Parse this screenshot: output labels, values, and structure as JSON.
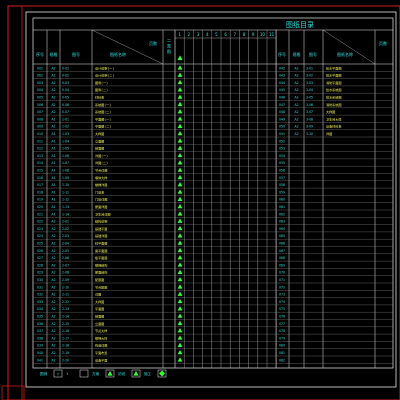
{
  "sheet": {
    "title": "图纸目录",
    "left_headers": {
      "seq": "序号",
      "size": "规格",
      "code": "图号",
      "name": "图纸名称",
      "diag": "页数"
    },
    "right_headers": {
      "seq": "序号",
      "size": "规格",
      "code": "图号",
      "name": "图纸名称",
      "diag": "页数"
    },
    "mid_header": "二类图",
    "cols": [
      "1",
      "2",
      "3",
      "4",
      "5",
      "6",
      "7",
      "8",
      "9",
      "10",
      "11"
    ],
    "left_rows": [
      {
        "seq": "001",
        "size": "A2",
        "code": "0-01",
        "name": "设计说明(一)"
      },
      {
        "seq": "002",
        "size": "A2",
        "code": "0-02",
        "name": "设计说明(二)"
      },
      {
        "seq": "003",
        "size": "A2",
        "code": "0-03",
        "name": "图例(一)"
      },
      {
        "seq": "004",
        "size": "A2",
        "code": "0-04",
        "name": "图例(二)"
      },
      {
        "seq": "005",
        "size": "A2",
        "code": "0-05",
        "name": "材料表"
      },
      {
        "seq": "006",
        "size": "A2",
        "code": "0-06",
        "name": "系统图(一)"
      },
      {
        "seq": "007",
        "size": "A2",
        "code": "0-07",
        "name": "系统图(二)"
      },
      {
        "seq": "008",
        "size": "A1",
        "code": "1-01",
        "name": "平面图(一)"
      },
      {
        "seq": "009",
        "size": "A1",
        "code": "1-02",
        "name": "平面图(二)"
      },
      {
        "seq": "010",
        "size": "A1",
        "code": "1-03",
        "name": "大样图"
      },
      {
        "seq": "011",
        "size": "A1",
        "code": "1-04",
        "name": "立面图"
      },
      {
        "seq": "012",
        "size": "A1",
        "code": "1-05",
        "name": "剖面图"
      },
      {
        "seq": "013",
        "size": "A1",
        "code": "1-06",
        "name": "详图(一)"
      },
      {
        "seq": "014",
        "size": "A1",
        "code": "1-07",
        "name": "详图(二)"
      },
      {
        "seq": "015",
        "size": "A1",
        "code": "1-08",
        "name": "节点详图"
      },
      {
        "seq": "016",
        "size": "A1",
        "code": "1-09",
        "name": "墙体大样"
      },
      {
        "seq": "017",
        "size": "A1",
        "code": "1-10",
        "name": "楼梯详图"
      },
      {
        "seq": "018",
        "size": "A1",
        "code": "1-11",
        "name": "门窗表"
      },
      {
        "seq": "019",
        "size": "A1",
        "code": "1-12",
        "name": "门窗详图"
      },
      {
        "seq": "020",
        "size": "A1",
        "code": "1-13",
        "name": "屋面详图"
      },
      {
        "seq": "021",
        "size": "A1",
        "code": "1-14",
        "name": "卫生间详图"
      },
      {
        "seq": "022",
        "size": "A2",
        "code": "2-01",
        "name": "结构说明"
      },
      {
        "seq": "023",
        "size": "A2",
        "code": "2-02",
        "name": "基础平面"
      },
      {
        "seq": "024",
        "size": "A2",
        "code": "2-03",
        "name": "基础详图"
      },
      {
        "seq": "025",
        "size": "A2",
        "code": "2-04",
        "name": "柱平面图"
      },
      {
        "seq": "026",
        "size": "A2",
        "code": "2-05",
        "name": "梁平面图"
      },
      {
        "seq": "027",
        "size": "A2",
        "code": "2-06",
        "name": "板平面图"
      },
      {
        "seq": "028",
        "size": "A2",
        "code": "2-07",
        "name": "楼梯结构"
      },
      {
        "seq": "029",
        "size": "A2",
        "code": "2-08",
        "name": "屋面结构"
      },
      {
        "seq": "030",
        "size": "A2",
        "code": "2-09",
        "name": "配筋图"
      },
      {
        "seq": "031",
        "size": "A2",
        "code": "2-10",
        "name": "节点配筋"
      },
      {
        "seq": "032",
        "size": "A2",
        "code": "2-11",
        "name": "详图"
      },
      {
        "seq": "033",
        "size": "A2",
        "code": "2-12",
        "name": "大样图"
      },
      {
        "seq": "034",
        "size": "A2",
        "code": "2-13",
        "name": "平面图"
      },
      {
        "seq": "035",
        "size": "A2",
        "code": "2-14",
        "name": "剖面图"
      },
      {
        "seq": "036",
        "size": "A2",
        "code": "2-15",
        "name": "立面图"
      },
      {
        "seq": "037",
        "size": "A2",
        "code": "2-16",
        "name": "节点大样"
      },
      {
        "seq": "038",
        "size": "A2",
        "code": "2-17",
        "name": "楼梯大样"
      },
      {
        "seq": "039",
        "size": "A2",
        "code": "2-18",
        "name": "构造详图"
      },
      {
        "seq": "040",
        "size": "A2",
        "code": "2-19",
        "name": "平面布置"
      },
      {
        "seq": "041",
        "size": "A2",
        "code": "2-20",
        "name": "设备平面"
      }
    ],
    "right_rows": [
      {
        "seq": "042",
        "size": "A2",
        "code": "3-01",
        "name": "给水平面图"
      },
      {
        "seq": "043",
        "size": "A2",
        "code": "3-02",
        "name": "排水平面图"
      },
      {
        "seq": "044",
        "size": "A2",
        "code": "3-03",
        "name": "消防平面图"
      },
      {
        "seq": "045",
        "size": "A2",
        "code": "3-04",
        "name": "给水系统图"
      },
      {
        "seq": "046",
        "size": "A2",
        "code": "3-05",
        "name": "排水系统图"
      },
      {
        "seq": "047",
        "size": "A2",
        "code": "3-06",
        "name": "消防系统图"
      },
      {
        "seq": "048",
        "size": "A2",
        "code": "3-07",
        "name": "大样图"
      },
      {
        "seq": "049",
        "size": "A2",
        "code": "3-08",
        "name": "卫生间大样"
      },
      {
        "seq": "050",
        "size": "A2",
        "code": "3-09",
        "name": "设备材料表"
      },
      {
        "seq": "051",
        "size": "A2",
        "code": "3-10",
        "name": "详图"
      }
    ],
    "right_empty_seqs": [
      "052",
      "053",
      "054",
      "055",
      "056",
      "057",
      "058",
      "059",
      "060",
      "061",
      "062",
      "063",
      "064",
      "065",
      "066",
      "067",
      "068",
      "069",
      "070",
      "071",
      "072",
      "073",
      "074",
      "075",
      "076",
      "077",
      "078",
      "079",
      "080",
      "081",
      "082"
    ],
    "legend": [
      {
        "label": "图例",
        "box": "T"
      },
      {
        "label": "1",
        "box": ""
      },
      {
        "label": "方案",
        "box": "tri"
      },
      {
        "label": "初设",
        "box": "tri"
      },
      {
        "label": "施工",
        "box": "dia"
      }
    ]
  }
}
